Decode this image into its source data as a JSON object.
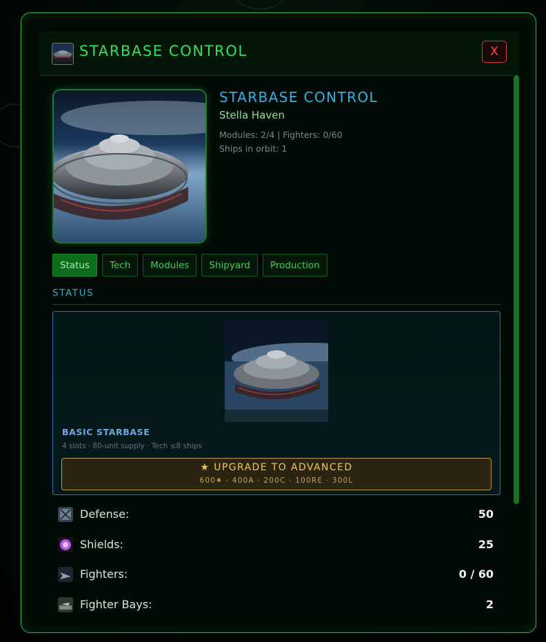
{
  "header": {
    "title": "STARBASE CONTROL",
    "close_label": "X"
  },
  "hero": {
    "title": "STARBASE CONTROL",
    "name": "Stella Haven",
    "modules_fighters": "Modules: 2/4 | Fighters: 0/60",
    "ships_in_orbit": "Ships in orbit: 1"
  },
  "tabs": [
    "Status",
    "Tech",
    "Modules",
    "Shipyard",
    "Production"
  ],
  "active_tab": "Status",
  "section": {
    "label": "STATUS"
  },
  "card": {
    "title": "BASIC STARBASE",
    "description": "4 slots · 80-unit supply · Tech ≤8 ships",
    "upgrade_label": "★ UPGRADE TO ADVANCED",
    "upgrade_cost": "600✷ · 400A · 200C · 100RE · 300L"
  },
  "stats": [
    {
      "label": "Defense:",
      "value": "50",
      "icon": "defense-icon"
    },
    {
      "label": "Shields:",
      "value": "25",
      "icon": "shields-icon"
    },
    {
      "label": "Fighters:",
      "value": "0 / 60",
      "icon": "fighters-icon"
    },
    {
      "label": "Fighter Bays:",
      "value": "2",
      "icon": "fighter-bays-icon"
    }
  ],
  "colors": {
    "accent_green": "#33e05a",
    "title_cyan": "#2fb4e8",
    "close_red": "#ff4a4a",
    "upgrade_gold": "#f0c860"
  }
}
